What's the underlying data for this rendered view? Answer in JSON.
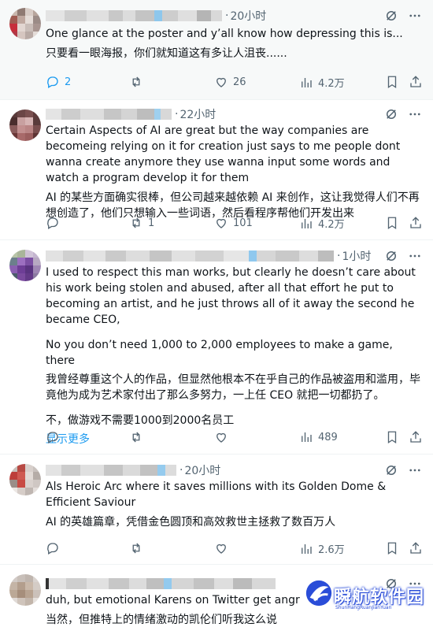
{
  "tweets": [
    {
      "time": "20小时",
      "lines": [
        "One glance at the poster and y’all know how depressing this is..."
      ],
      "cn_lines": [
        "只要看一眼海报，你们就知道这有多让人沮丧......"
      ],
      "stats": {
        "reply": "2",
        "retweet": "",
        "like": "26",
        "views": "4.2万"
      }
    },
    {
      "time": "22小时",
      "lines": [
        "Certain Aspects of AI are great but the way companies are becomeing relying on it for creation just says to me people dont wanna create anymore they use wanna input some words and watch a program develop it for them"
      ],
      "cn_lines": [
        "AI 的某些方面确实很棒，但公司越来越依赖 AI 来创作，这让我觉得人们不再想创造了，他们只想输入一些词语，然后看程序帮他们开发出来"
      ],
      "stats": {
        "reply": "",
        "retweet": "1",
        "like": "101",
        "views": "4.2万"
      }
    },
    {
      "time": "1小时",
      "lines": [
        "I used to respect this man works, but clearly he doesn’t care about his work being stolen and abused, after all that effort he put to becoming an artist, and he just throws all of it away the second he became CEO,",
        "No you don’t need 1,000 to 2,000 employees to make a game, there"
      ],
      "cn_lines": [
        "我曾经尊重这个人的作品，但显然他根本不在乎自己的作品被盗用和滥用，毕竟他为成为艺术家付出了那么多努力，一上任 CEO 就把一切都扔了。",
        "不，做游戏不需要1000到2000名员工"
      ],
      "show_more": "显示更多",
      "stats": {
        "reply": "",
        "retweet": "",
        "like": "",
        "views": "489"
      }
    },
    {
      "time": "20小时",
      "lines": [
        "Als Heroic Arc where it saves millions with its Golden Dome & Efficient Saviour"
      ],
      "cn_lines": [
        "AI 的英雄篇章，凭借金色圆顶和高效救世主拯救了数百万人"
      ],
      "stats": {
        "reply": "",
        "retweet": "",
        "like": "",
        "views": "2.6万"
      }
    },
    {
      "time": "",
      "lines": [
        "duh, but emotional Karens on Twitter  get angr"
      ],
      "cn_lines": [
        "当然，但推特上的情绪激动的凯伦们听我这么说"
      ],
      "stats": {
        "reply": "",
        "retweet": "",
        "like": "",
        "views": ""
      }
    }
  ],
  "watermark": {
    "title": "瞬航软件园",
    "subtitle": "ShunHangRuanJianYuan"
  },
  "colors": {
    "accent": "#1d9bf0",
    "muted": "#536471",
    "text": "#0f1419",
    "highlight_bg": "#f7f9f9"
  }
}
